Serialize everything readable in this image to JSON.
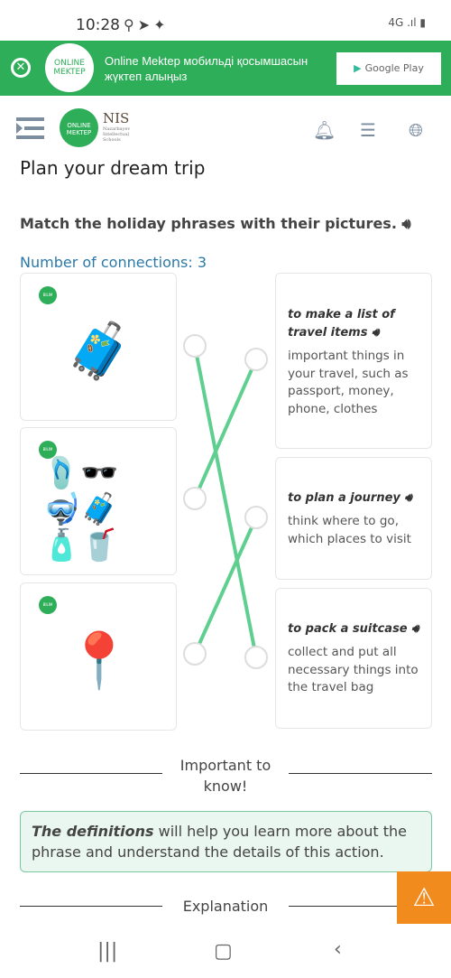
{
  "status": {
    "time": "10:28",
    "network": "4G"
  },
  "banner": {
    "text": "Online Mektep мобильді қосымшасын жүктеп алыңыз",
    "logo": "ONLINE MEKTEP",
    "store_button": "Google Play"
  },
  "header": {
    "logo": "ONLINE MEKTEP",
    "nis": "NIS",
    "nis_sub": "Nazarbayev Intellectual Schools"
  },
  "page": {
    "title": "Plan your dream trip",
    "instruction": "Match the holiday phrases with their pictures.",
    "connections": "Number of connections: 3"
  },
  "left": [
    {
      "icon": "suitcase"
    },
    {
      "icon": "beach-items"
    },
    {
      "icon": "map-route"
    }
  ],
  "right": [
    {
      "phrase": "to make a list of travel items",
      "definition": "important things in your travel, such as passport, money, phone, clothes"
    },
    {
      "phrase": "to plan a journey",
      "definition": "think where to go, which places to visit"
    },
    {
      "phrase": "to pack a suitcase",
      "definition": "collect and put all necessary things into the travel bag"
    }
  ],
  "matches": [
    [
      0,
      2
    ],
    [
      1,
      0
    ],
    [
      2,
      1
    ]
  ],
  "important": {
    "heading": "Important to know!",
    "text_bold": "The definitions",
    "text_rest": " will help you learn more about the phrase and understand the details of this action."
  },
  "explanation": "Explanation",
  "colors": {
    "brand": "#2fae5a",
    "line": "#5fcf8f",
    "link": "#2b79a8",
    "warning": "#f28b1e"
  }
}
